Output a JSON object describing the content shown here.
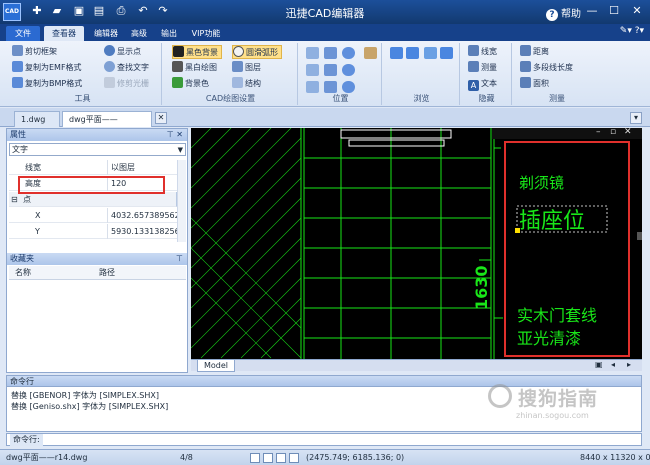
{
  "window": {
    "title": "迅捷CAD编辑器",
    "logo_text": "CAD",
    "help_label": "帮助"
  },
  "menu_tabs": [
    {
      "label": "文件"
    },
    {
      "label": "查看器"
    },
    {
      "label": "编辑器"
    },
    {
      "label": "高级"
    },
    {
      "label": "输出"
    },
    {
      "label": "VIP功能"
    }
  ],
  "ribbon": {
    "tools": {
      "label": "工具",
      "items": [
        "剪切框架",
        "复制为EMF格式",
        "复制为BMP格式",
        "显示点",
        "查找文字",
        "修剪光栅"
      ]
    },
    "cad_settings": {
      "label": "CAD绘图设置",
      "items": [
        "黑色背景",
        "黑白绘图",
        "背景色",
        "圆滑弧形",
        "图层",
        "结构"
      ]
    },
    "position": {
      "label": "位置"
    },
    "browse": {
      "label": "浏览"
    },
    "hide": {
      "label": "隐藏",
      "items": [
        "线宽",
        "测量",
        "文本"
      ]
    },
    "measure": {
      "label": "测量",
      "items": [
        "距离",
        "多段线长度",
        "面积"
      ]
    }
  },
  "doc_tabs": [
    {
      "label": "1.dwg"
    },
    {
      "label": "dwg平面——r14.dwg"
    }
  ],
  "properties": {
    "title": "属性",
    "selected_type": "文字",
    "rows": [
      {
        "key": "线宽",
        "value": "以图层"
      },
      {
        "key": "高度",
        "value": "120"
      },
      {
        "key": "点",
        "value": ""
      },
      {
        "key": "X",
        "value": "4032.657389562"
      },
      {
        "key": "Y",
        "value": "5930.133138256"
      }
    ]
  },
  "favorites": {
    "title": "收藏夹",
    "columns": [
      "名称",
      "路径"
    ]
  },
  "drawing": {
    "texts": [
      "剃须镜",
      "插座位",
      "1630",
      "实木门套线",
      "亚光清漆"
    ],
    "model_tab": "Model"
  },
  "command": {
    "title": "命令行",
    "output": [
      "替换 [GBENOR] 字体为 [SIMPLEX.SHX]",
      "替换 [Geniso.shx] 字体为 [SIMPLEX.SHX]"
    ],
    "prompt_label": "命令行:"
  },
  "status": {
    "file": "dwg平面——r14.dwg",
    "page": "4/8",
    "coords": "(2475.749; 6185.136; 0)",
    "size": "8440 x 11320 x 0"
  },
  "watermark": {
    "title": "搜狗指南",
    "url": "zhinan.sogou.com"
  },
  "colors": {
    "cad_green": "#19e619",
    "highlight_red": "#e0302c",
    "ribbon_blue": "#16418a"
  }
}
